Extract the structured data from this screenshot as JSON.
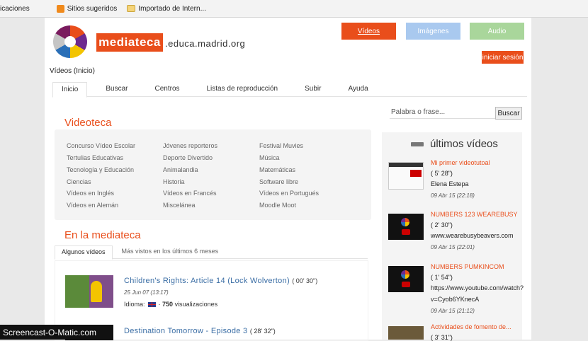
{
  "bookmarks": [
    {
      "label": "icaciones",
      "icon": "none"
    },
    {
      "label": "Sitios sugeridos",
      "icon": "suggested-sites-icon"
    },
    {
      "label": "Importado de Intern...",
      "icon": "folder-icon"
    }
  ],
  "colors": {
    "accent": "#e94e1b",
    "link": "#3b6ea5",
    "videos_btn": "#e94e1b",
    "imagenes_btn": "#a9c9ef",
    "audio_btn": "#a9d69b"
  },
  "header": {
    "brand": "mediateca",
    "brand_tail": ".educa.madrid.org",
    "btn_videos": "Vídeos",
    "btn_imagenes": "Imágenes",
    "btn_audio": "Audio",
    "login": "iniciar sesión"
  },
  "breadcrumb": "Vídeos (Inicio)",
  "tabs": [
    "Inicio",
    "Buscar",
    "Centros",
    "Listas de reproducción",
    "Subir",
    "Ayuda"
  ],
  "search": {
    "placeholder": "Palabra o frase...",
    "button": "Buscar"
  },
  "videoteca": {
    "title": "Videoteca",
    "col1": [
      "Concurso Vídeo Escolar",
      "Tertulias Educativas",
      "Tecnología y Educación",
      "Ciencias",
      "Vídeos en Inglés",
      "Vídeos en Alemán"
    ],
    "col2": [
      "Jóvenes reporteros",
      "Deporte Divertido",
      "Animalandia",
      "Historia",
      "Vídeos en Francés",
      "Miscelánea"
    ],
    "col3": [
      "Festival Muvies",
      "Música",
      "Matemáticas",
      "Software libre",
      "Vídeos en Portugués",
      "Moodle Moot"
    ]
  },
  "enlamediateca": {
    "title": "En la mediateca",
    "subtabs": [
      "Algunos vídeos",
      "Más vistos en los últimos 6 meses"
    ],
    "items": [
      {
        "title": "Children's Rights: Article 14 (Lock Wolverton)",
        "duration": "( 00' 30\")",
        "date": "25 Jun 07 (13:17)",
        "idioma": "Idioma:",
        "views_count": "750",
        "views_label": "visualizaciones"
      },
      {
        "title": "Destination Tomorrow - Episode 3",
        "duration": "( 28' 32\")"
      }
    ]
  },
  "sidebar": {
    "title": "últimos vídeos",
    "videos": [
      {
        "title": "Mi primer videotutoal",
        "duration": "( 5' 28\")",
        "author": "Elena Estepa",
        "date": "09 Abr 15 (22:18)"
      },
      {
        "title": "NUMBERS 123 WEAREBUSY",
        "duration": "( 2' 30\")",
        "author": "www.wearebusybeavers.com",
        "date": "09 Abr 15 (22:01)"
      },
      {
        "title": "NUMBERS PUMKINCOM",
        "duration": "( 1' 54\")",
        "author": "https://www.youtube.com/watch?",
        "author2": "v=Cyob6YKnecA",
        "date": "09 Abr 15 (21:12)"
      },
      {
        "title": "Actividades de fomento de...",
        "duration": "( 3' 31\")"
      }
    ]
  },
  "watermark": "Screencast-O-Matic.com"
}
